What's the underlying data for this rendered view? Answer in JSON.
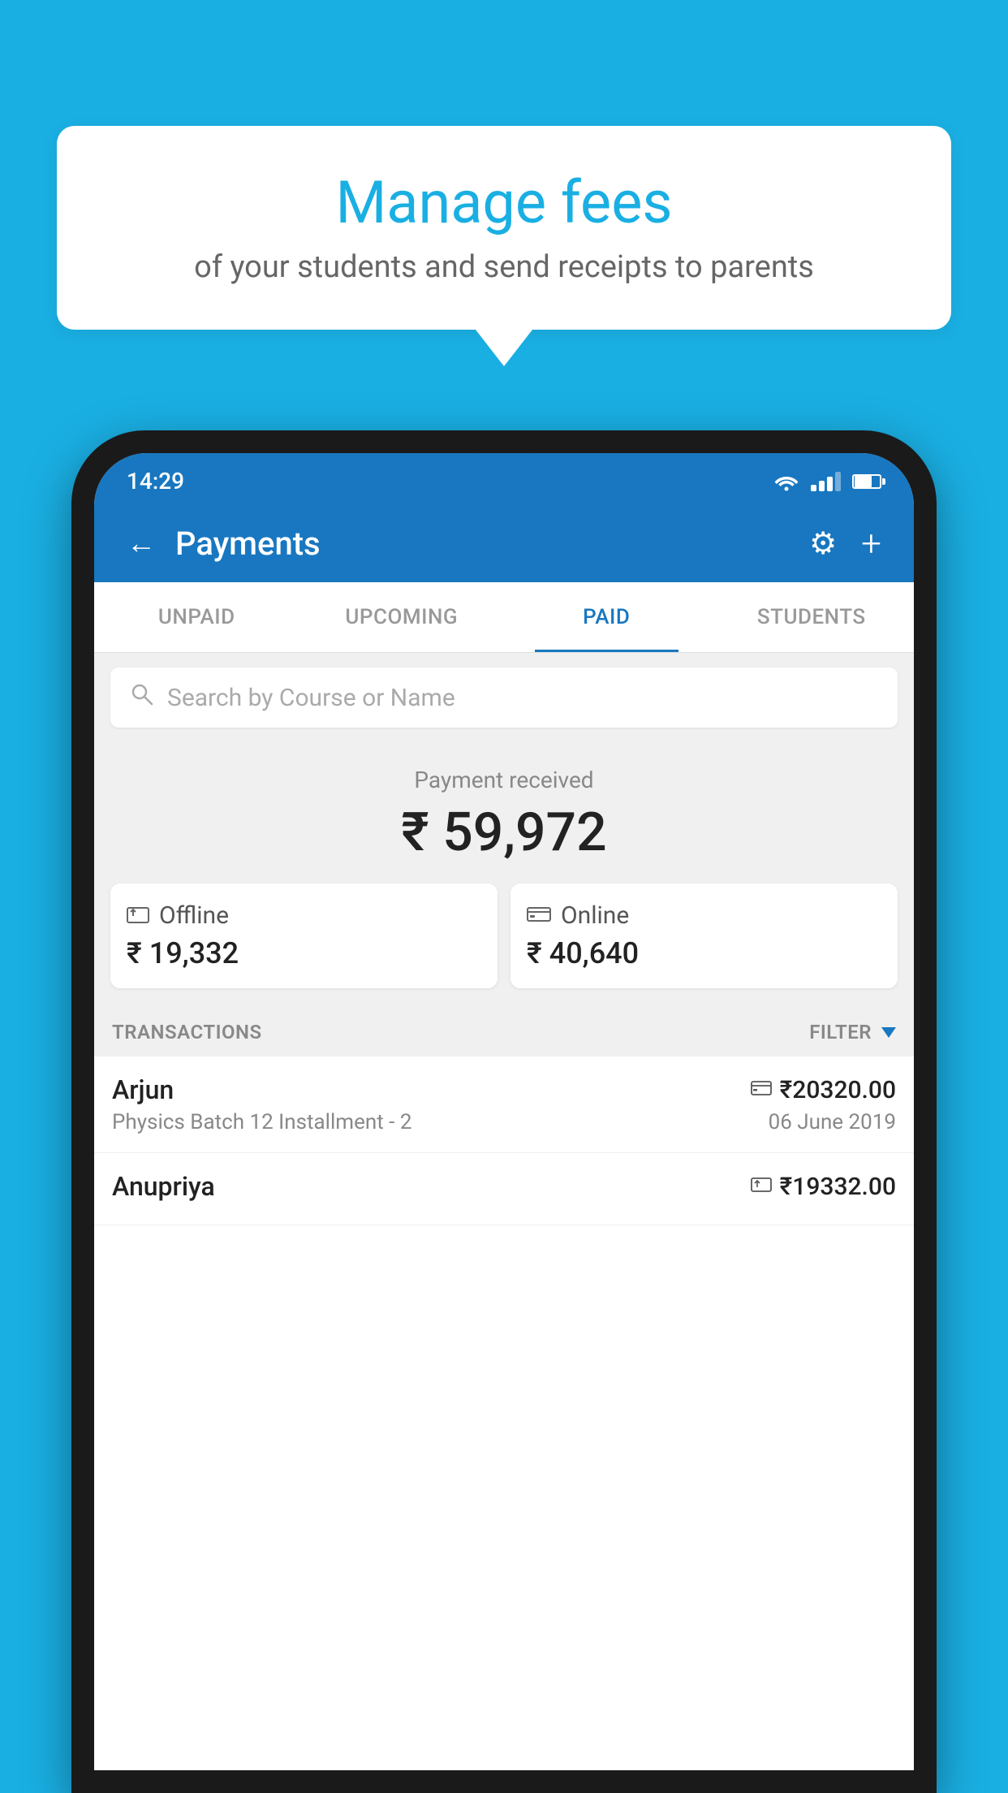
{
  "background_color": "#1AAFE3",
  "speech_bubble": {
    "title": "Manage fees",
    "subtitle": "of your students and send receipts to parents"
  },
  "status_bar": {
    "time": "14:29"
  },
  "app_header": {
    "title": "Payments",
    "back_label": "←",
    "gear_label": "⚙",
    "plus_label": "+"
  },
  "tabs": [
    {
      "label": "UNPAID",
      "active": false
    },
    {
      "label": "UPCOMING",
      "active": false
    },
    {
      "label": "PAID",
      "active": true
    },
    {
      "label": "STUDENTS",
      "active": false
    }
  ],
  "search": {
    "placeholder": "Search by Course or Name"
  },
  "payment_received": {
    "label": "Payment received",
    "amount": "₹ 59,972"
  },
  "payment_cards": [
    {
      "type": "Offline",
      "amount": "₹ 19,332",
      "icon": "💳"
    },
    {
      "type": "Online",
      "amount": "₹ 40,640",
      "icon": "💳"
    }
  ],
  "transactions_section": {
    "label": "TRANSACTIONS",
    "filter_label": "FILTER"
  },
  "transactions": [
    {
      "name": "Arjun",
      "course": "Physics Batch 12 Installment - 2",
      "amount": "₹20320.00",
      "date": "06 June 2019",
      "payment_type": "online"
    },
    {
      "name": "Anupriya",
      "course": "",
      "amount": "₹19332.00",
      "date": "",
      "payment_type": "offline"
    }
  ]
}
